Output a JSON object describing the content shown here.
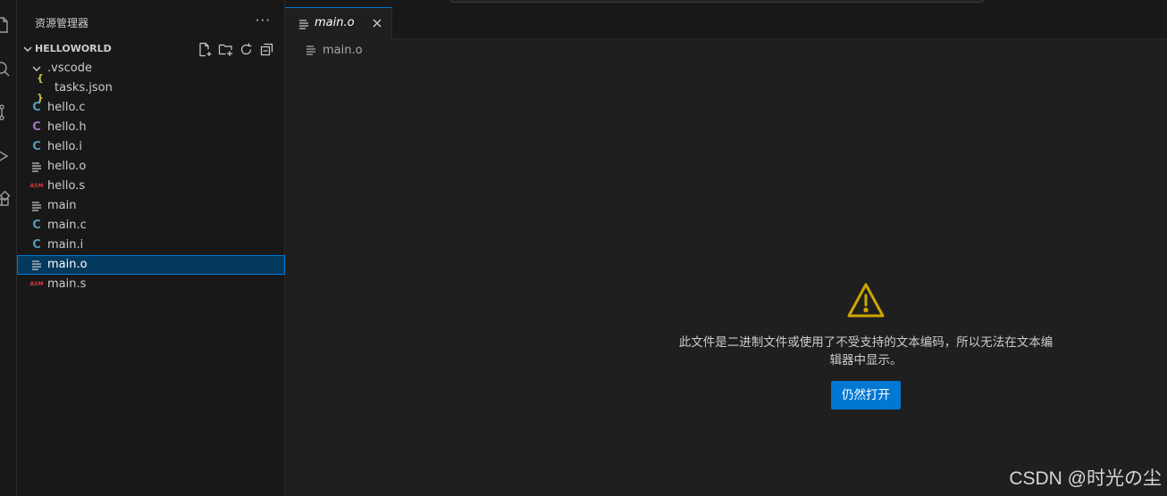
{
  "explorer": {
    "title": "资源管理器",
    "more": "···",
    "folder": "HELLOWORLD",
    "actions": [
      "new-file-icon",
      "new-folder-icon",
      "refresh-icon",
      "collapse-all-icon"
    ]
  },
  "tree": [
    {
      "label": ".vscode",
      "icon": "chevron-down-icon",
      "kind": "folder",
      "indent": 1
    },
    {
      "label": "tasks.json",
      "icon": "json-icon",
      "kind": "json",
      "indent": 2
    },
    {
      "label": "hello.c",
      "icon": "c-file-icon",
      "kind": "c",
      "indent": 1
    },
    {
      "label": "hello.h",
      "icon": "header-file-icon",
      "kind": "h",
      "indent": 1
    },
    {
      "label": "hello.i",
      "icon": "c-file-icon",
      "kind": "c",
      "indent": 1
    },
    {
      "label": "hello.o",
      "icon": "plain-file-icon",
      "kind": "lines",
      "indent": 1
    },
    {
      "label": "hello.s",
      "icon": "asm-file-icon",
      "kind": "asm",
      "indent": 1
    },
    {
      "label": "main",
      "icon": "plain-file-icon",
      "kind": "lines",
      "indent": 1
    },
    {
      "label": "main.c",
      "icon": "c-file-icon",
      "kind": "c",
      "indent": 1
    },
    {
      "label": "main.i",
      "icon": "c-file-icon",
      "kind": "c",
      "indent": 1
    },
    {
      "label": "main.o",
      "icon": "plain-file-icon",
      "kind": "lines",
      "indent": 1,
      "selected": true
    },
    {
      "label": "main.s",
      "icon": "asm-file-icon",
      "kind": "asm",
      "indent": 1
    }
  ],
  "icon_text": {
    "c": "C",
    "h": "C",
    "json": "{ }",
    "asm": "ASM"
  },
  "editor": {
    "tab_label": "main.o",
    "breadcrumb": "main.o",
    "notice": "此文件是二进制文件或使用了不受支持的文本编码，所以无法在文本编辑器中显示。",
    "open_anyway": "仍然打开"
  },
  "watermark": "CSDN @时光の尘",
  "colors": {
    "accent": "#0078d4",
    "warning": "#cca700",
    "c_icon": "#519aba",
    "h_icon": "#a074c4",
    "json_icon": "#cbcb41",
    "asm_icon": "#cc3e44"
  }
}
